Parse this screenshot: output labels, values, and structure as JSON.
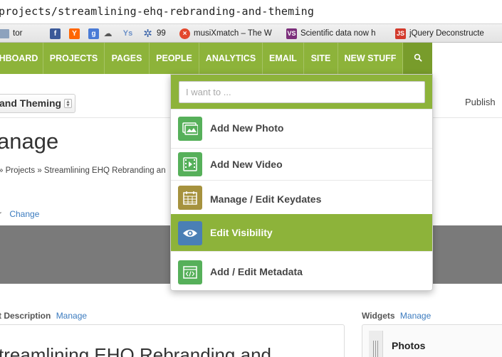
{
  "browser": {
    "url": "projects/streamlining-ehq-rebranding-and-theming",
    "bookmarks": [
      {
        "label": "tor",
        "icon": "folder-icon",
        "color": "#8da2bd"
      },
      {
        "label": "",
        "icon": "facebook-icon",
        "color": "#3b5998"
      },
      {
        "label": "",
        "icon": "hackernews-icon",
        "color": "#ff6600"
      },
      {
        "label": "",
        "icon": "google-icon",
        "color": "#4a7bd6"
      },
      {
        "label": "",
        "icon": "cloud-icon",
        "color": "#666666"
      },
      {
        "label": "",
        "icon": "yahoo-icon",
        "color": "#6a8fc7"
      },
      {
        "label": "99",
        "icon": "gear-icon",
        "color": "#3a63a8"
      },
      {
        "label": "musiXmatch – The W",
        "icon": "musixmatch-icon",
        "color": "#e3482d"
      },
      {
        "label": "Scientific data now h",
        "icon": "vs-icon",
        "color": "#7b2e7a"
      },
      {
        "label": "jQuery Deconstructe",
        "icon": "js-icon",
        "color": "#d33a2c"
      }
    ]
  },
  "nav": {
    "items": [
      "HBOARD",
      "PROJECTS",
      "PAGES",
      "PEOPLE",
      "ANALYTICS",
      "EMAIL",
      "SITE",
      "NEW STUFF"
    ],
    "search_icon": "search-icon",
    "active_color": "#8db33a"
  },
  "subheader": {
    "project_select": "and Theming",
    "publish": "Publish"
  },
  "main": {
    "title": "anage",
    "breadcrumb": "» Projects » Streamlining EHQ Rebranding an",
    "owner_label": "r",
    "change_link": "Change",
    "description_label": "t Description",
    "description_manage": "Manage",
    "description_heading": "treamlining EHQ Rebranding and",
    "widgets_label": "Widgets",
    "widgets_manage": "Manage",
    "widget_title": "Photos"
  },
  "dropdown": {
    "placeholder": "I want to ...",
    "items": [
      {
        "label": "Add New Photo",
        "icon": "photo-icon",
        "color": "#56b05a"
      },
      {
        "label": "Add New Video",
        "icon": "video-icon",
        "color": "#56b05a"
      },
      {
        "label": "Manage / Edit Keydates",
        "icon": "calendar-icon",
        "color": "#a6923e"
      },
      {
        "label": "Edit Visibility",
        "icon": "eye-icon",
        "color": "#4a7fb5"
      },
      {
        "label": "Add / Edit Metadata",
        "icon": "code-icon",
        "color": "#56b05a"
      }
    ]
  }
}
